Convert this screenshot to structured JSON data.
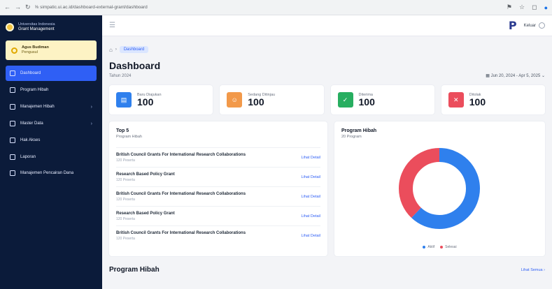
{
  "browser": {
    "url": "% simpatic.ui.ac.id/dashboard-external-grant/dashboard",
    "nav": [
      "←",
      "→",
      "↻"
    ],
    "right_icons": [
      "⚑",
      "☆",
      "◻"
    ]
  },
  "sidebar": {
    "brand_line1": "Universitas Indonesia",
    "brand_line2": "Grant Management",
    "user_name": "Agus Budiman",
    "user_role": "Pengusul",
    "items": [
      {
        "label": "Dashboard",
        "active": true,
        "has_chevron": false
      },
      {
        "label": "Program Hibah",
        "active": false,
        "has_chevron": false
      },
      {
        "label": "Manajemen Hibah",
        "active": false,
        "has_chevron": true
      },
      {
        "label": "Master Data",
        "active": false,
        "has_chevron": true
      },
      {
        "label": "Hak Akses",
        "active": false,
        "has_chevron": false
      },
      {
        "label": "Laporan",
        "active": false,
        "has_chevron": false
      },
      {
        "label": "Manajemen Pencairan Dana",
        "active": false,
        "has_chevron": false
      }
    ]
  },
  "topbar": {
    "logo_glyph": "P",
    "user_label": "Keluar"
  },
  "breadcrumb": {
    "home_icon": "⌂",
    "separator": "›",
    "current": "Dashboard"
  },
  "page": {
    "title": "Dashboard",
    "subtitle": "Tahun 2024",
    "date_range": "Jun 20, 2024 - Apr 5, 2025"
  },
  "stats": [
    {
      "label": "Baru Diajukan",
      "value": "100",
      "color": "#2f80ed",
      "icon": "document-icon",
      "glyph": "▤"
    },
    {
      "label": "Sedang Ditinjau",
      "value": "100",
      "color": "#f2994a",
      "icon": "user-icon",
      "glyph": "☺"
    },
    {
      "label": "Diterima",
      "value": "100",
      "color": "#27ae60",
      "icon": "check-icon",
      "glyph": "✓"
    },
    {
      "label": "Ditolak",
      "value": "100",
      "color": "#eb4d5c",
      "icon": "close-icon",
      "glyph": "✕"
    }
  ],
  "top5": {
    "title": "Top 5",
    "subtitle": "Program Hibah",
    "link_label": "Lihat Detail",
    "items": [
      {
        "title": "British Council Grants For International Research Collaborations",
        "sub": "120 Peserta"
      },
      {
        "title": "Research Based Policy Grant",
        "sub": "120 Peserta"
      },
      {
        "title": "British Council Grants For International Research Collaborations",
        "sub": "120 Peserta"
      },
      {
        "title": "Research Based Policy Grant",
        "sub": "120 Peserta"
      },
      {
        "title": "British Council Grants For International Research Collaborations",
        "sub": "120 Peserta"
      }
    ]
  },
  "hibah_chart": {
    "title": "Program Hibah",
    "subtitle": "20 Program"
  },
  "chart_data": {
    "type": "pie",
    "donut": true,
    "series": [
      {
        "name": "Aktif",
        "value": 62,
        "color": "#2f80ed"
      },
      {
        "name": "Selesai",
        "value": 38,
        "color": "#eb4d5c"
      }
    ],
    "legend_position": "bottom"
  },
  "section": {
    "title": "Program Hibah",
    "link": "Lihat Semua"
  }
}
